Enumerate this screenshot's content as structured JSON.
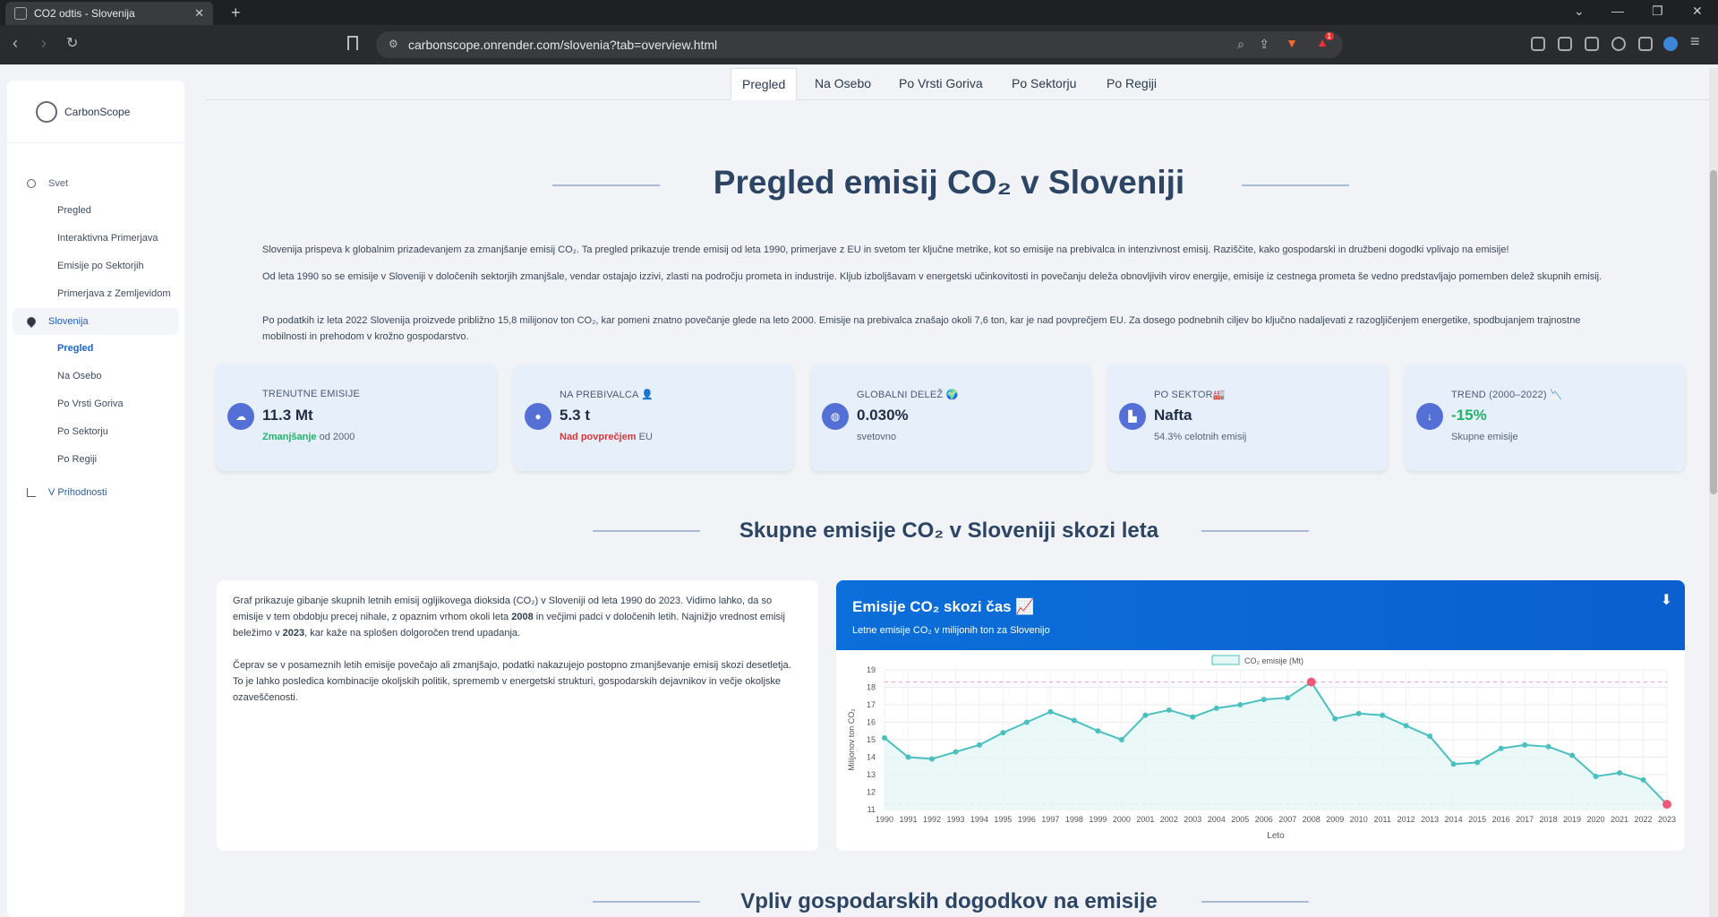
{
  "browser": {
    "tab_title": "CO2 odtis - Slovenija",
    "url": "carbonscope.onrender.com/slovenia?tab=overview.html",
    "ext_badge": "1"
  },
  "sidebar": {
    "brand": "CarbonScope",
    "items": [
      {
        "label": "Svet",
        "subs": [
          "Pregled",
          "Interaktivna Primerjava",
          "Emisije po Sektorjih",
          "Primerjava z Zemljevidom"
        ]
      },
      {
        "label": "Slovenija",
        "subs": [
          "Pregled",
          "Na Osebo",
          "Po Vrsti Goriva",
          "Po Sektorju",
          "Po Regiji"
        ]
      },
      {
        "label": "V Prihodnosti",
        "subs": []
      }
    ]
  },
  "topnav": [
    "Pregled",
    "Na Osebo",
    "Po Vrsti Goriva",
    "Po Sektorju",
    "Po Regiji"
  ],
  "title": "Pregled emisij CO₂ v Sloveniji",
  "paragraphs": [
    "Slovenija prispeva k globalnim prizadevanjem za zmanjšanje emisij CO₂. Ta pregled prikazuje trende emisij od leta 1990, primerjave z EU in svetom ter ključne metrike, kot so emisije na prebivalca in intenzivnost emisij. Raziščite, kako gospodarski in družbeni dogodki vplivajo na emisije!",
    "Od leta 1990 so se emisije v Sloveniji v določenih sektorjih zmanjšale, vendar ostajajo izzivi, zlasti na področju prometa in industrije. Kljub izboljšavam v energetski učinkovitosti in povečanju deleža obnovljivih virov energije, emisije iz cestnega prometa še vedno predstavljajo pomemben delež skupnih emisij.",
    "Po podatkih iz leta 2022 Slovenija proizvede približno 15,8 milijonov ton CO₂, kar pomeni znatno povečanje glede na leto 2000. Emisije na prebivalca znašajo okoli 7,6 ton, kar je nad povprečjem EU. Za dosego podnebnih ciljev bo ključno nadaljevati z razogljičenjem energetike, spodbujanjem trajnostne mobilnosti in prehodom v krožno gospodarstvo."
  ],
  "cards": [
    {
      "label": "TRENUTNE EMISIJE",
      "value": "11.3 Mt",
      "hi": "Zmanjšanje",
      "rest": " od 2000",
      "cls": "green"
    },
    {
      "label": "NA PREBIVALCA 👤",
      "value": "5.3 t",
      "hi": "Nad povprečjem",
      "rest": " EU",
      "cls": "red"
    },
    {
      "label": "GLOBALNI DELEŽ 🌍",
      "value": "0.030%",
      "hi": "",
      "rest": "svetovno",
      "cls": ""
    },
    {
      "label": "PO SEKTOR🏭",
      "value": "Nafta",
      "hi": "",
      "rest": "54.3% celotnih emisij",
      "cls": ""
    },
    {
      "label": "TREND (2000–2022) 📉",
      "value": "-15%",
      "hi": "",
      "rest": "Skupne emisije",
      "cls": "",
      "valcolor": "#22b36a"
    }
  ],
  "section2": "Skupne emisije CO₂ v Sloveniji skozi leta",
  "section3": "Vpliv gospodarskih dogodkov na emisije",
  "text1": "Graf prikazuje gibanje skupnih letnih emisij ogljikovega dioksida (CO₂) v Sloveniji od leta 1990 do 2023. Vidimo lahko, da so emisije v tem obdobju precej nihale, z opaznim vrhom okoli leta 2008 in večjimi padci v določenih letih. Najnižjo vrednost emisij beležimo v 2023, kar kaže na splošen dolgoročen trend upadanja.",
  "text2": "Čeprav se v posameznih letih emisije povečajo ali zmanjšajo, podatki nakazujejo postopno zmanjševanje emisij skozi desetletja. To je lahko posledica kombinacije okoljskih politik, sprememb v energetski strukturi, gospodarskih dejavnikov in večje okoljske ozaveščenosti.",
  "chart_card": {
    "title": "Emisije CO₂ skozi čas 📈",
    "subtitle": "Letne emisije CO₂ v milijonih ton za Slovenijo"
  },
  "chart_data": {
    "type": "line",
    "x": [
      1990,
      1991,
      1992,
      1993,
      1994,
      1995,
      1996,
      1997,
      1998,
      1999,
      2000,
      2001,
      2002,
      2003,
      2004,
      2005,
      2006,
      2007,
      2008,
      2009,
      2010,
      2011,
      2012,
      2013,
      2014,
      2015,
      2016,
      2017,
      2018,
      2019,
      2020,
      2021,
      2022,
      2023
    ],
    "series": [
      {
        "name": "CO₂ emisije (Mt)",
        "values": [
          15.1,
          14.0,
          13.9,
          14.3,
          14.7,
          15.4,
          16.0,
          16.6,
          16.1,
          15.5,
          15.0,
          16.4,
          16.7,
          16.3,
          16.8,
          17.0,
          17.3,
          17.4,
          18.3,
          16.2,
          16.5,
          16.4,
          15.8,
          15.2,
          13.6,
          13.7,
          14.5,
          14.7,
          14.6,
          14.1,
          12.9,
          13.1,
          12.7,
          11.3
        ]
      }
    ],
    "xlabel": "Leto",
    "ylabel": "Milijonov ton CO₂",
    "ylim": [
      11,
      19
    ],
    "grid": true,
    "legend": "top",
    "colors": {
      "line": "#4bc0c0",
      "fill": "#e5f6f6",
      "highlight": "#ef5a78",
      "ref": "#f29aae"
    }
  }
}
